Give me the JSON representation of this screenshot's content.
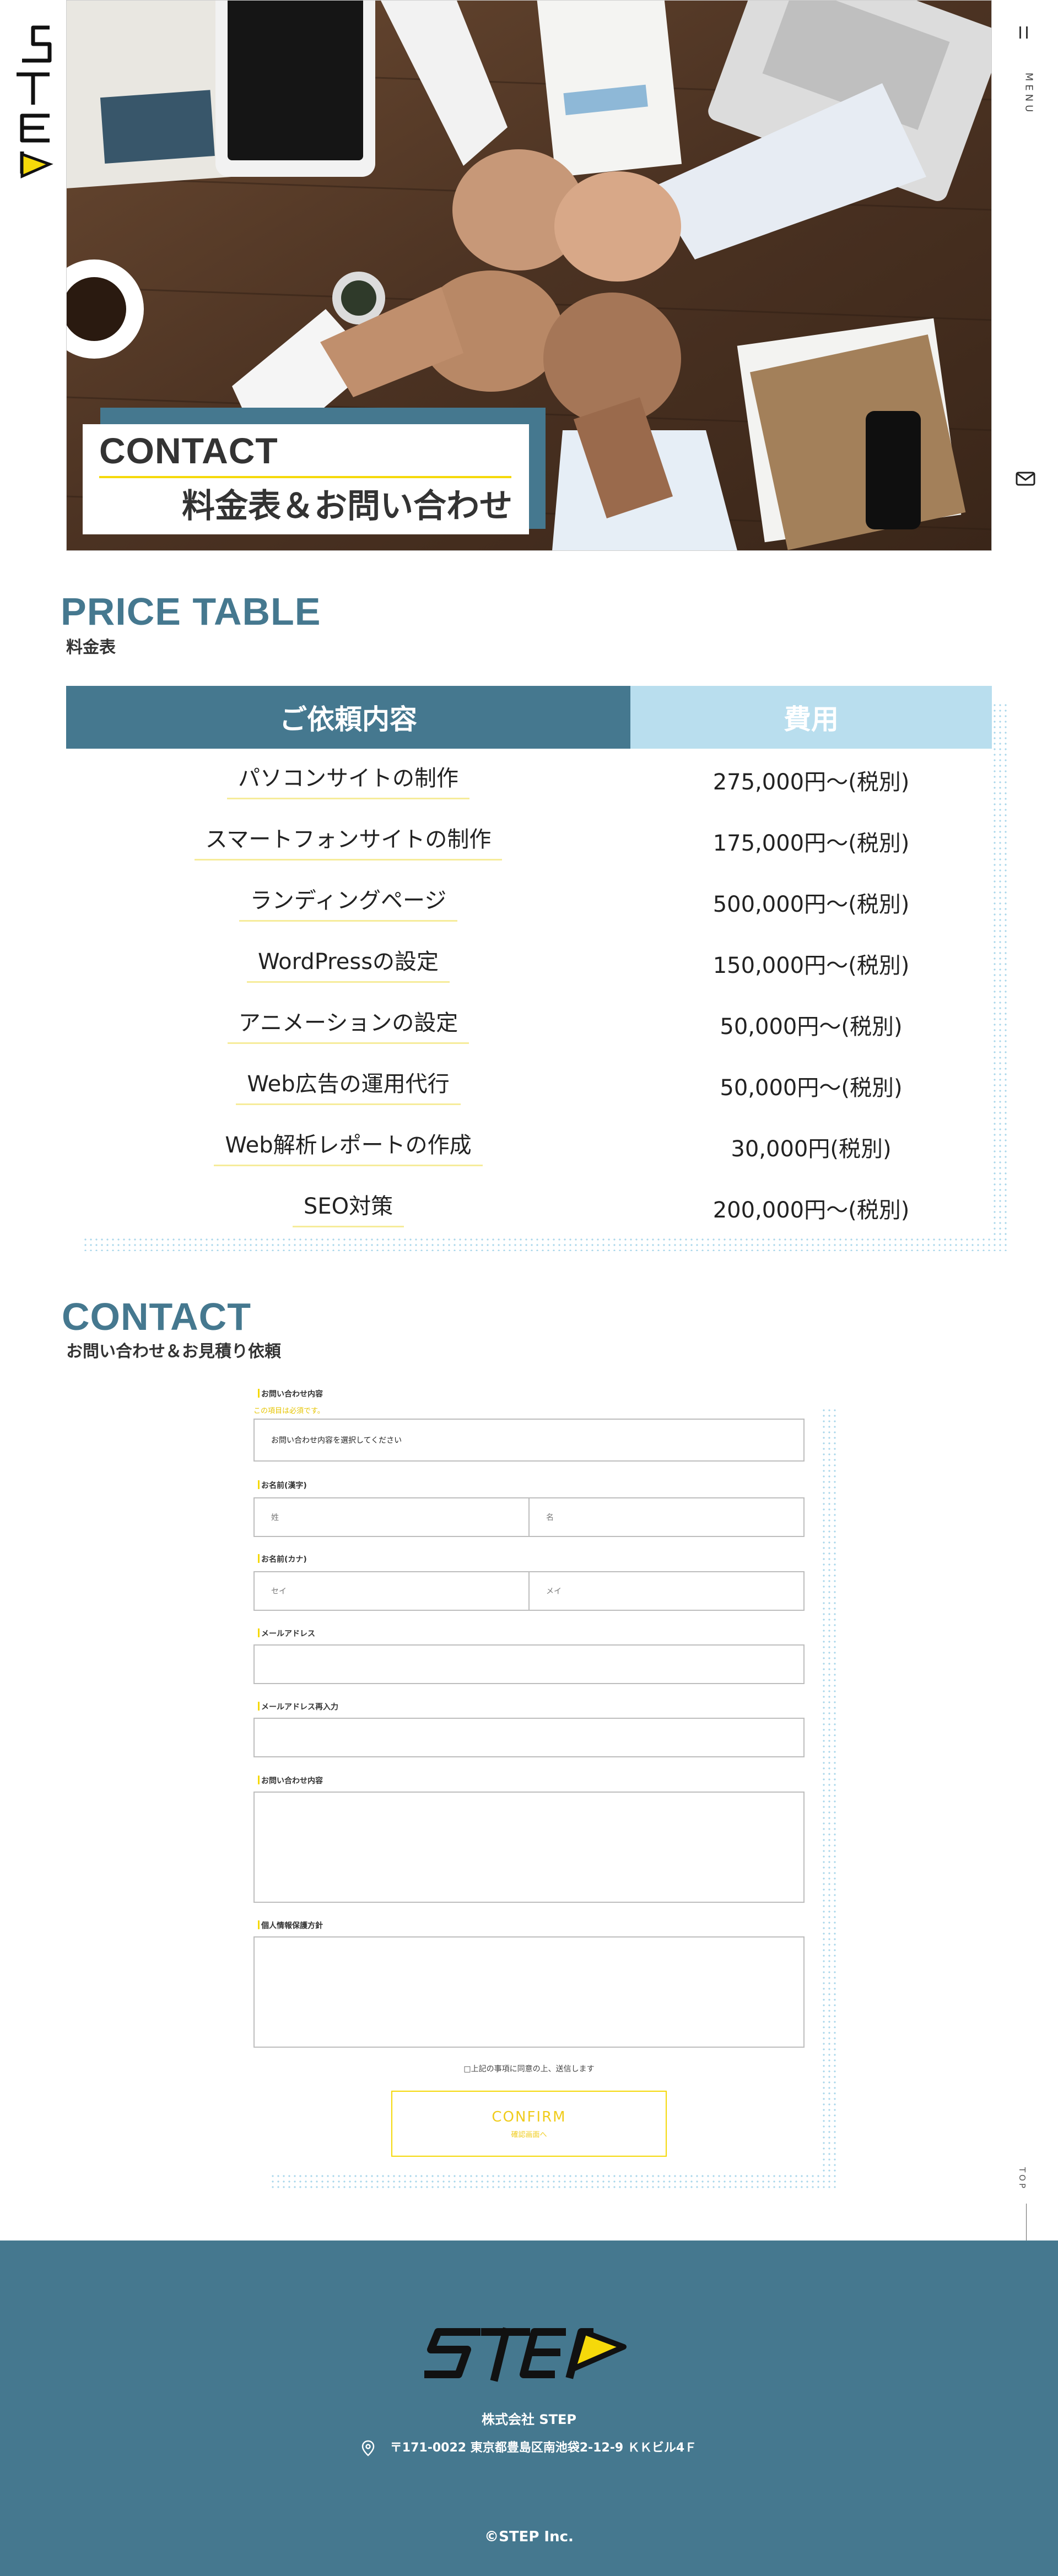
{
  "brand": {
    "logo_text": "STEP",
    "accent": "#f5d90a",
    "primary": "#45788f",
    "light": "#b9deee"
  },
  "nav": {
    "menu_label": "MENU",
    "top_label": "TOP"
  },
  "hero": {
    "title": "CONTACT",
    "subtitle": "料金表＆お問い合わせ"
  },
  "price_section": {
    "title": "PRICE TABLE",
    "subtitle": "料金表",
    "headers": {
      "item": "ご依頼内容",
      "price": "費用"
    },
    "rows": [
      {
        "item": "パソコンサイトの制作",
        "price": "275,000円〜(税別)"
      },
      {
        "item": "スマートフォンサイトの制作",
        "price": "175,000円〜(税別)"
      },
      {
        "item": "ランディングページ",
        "price": "500,000円〜(税別)"
      },
      {
        "item": "WordPressの設定",
        "price": "150,000円〜(税別)"
      },
      {
        "item": "アニメーションの設定",
        "price": "50,000円〜(税別)"
      },
      {
        "item": "Web広告の運用代行",
        "price": "50,000円〜(税別)"
      },
      {
        "item": "Web解析レポートの作成",
        "price": "30,000円(税別)"
      },
      {
        "item": "SEO対策",
        "price": "200,000円〜(税別)"
      }
    ]
  },
  "contact_section": {
    "title": "CONTACT",
    "subtitle": "お問い合わせ＆お見積り依頼",
    "form": {
      "inquiry_type_label": "お問い合わせ内容",
      "inquiry_type_note": "この項目は必須です。",
      "inquiry_type_value": "お問い合わせ内容を選択してください",
      "name_label": "お名前(漢字)",
      "last_name_placeholder": "姓",
      "first_name_placeholder": "名",
      "kana_label": "お名前(カナ)",
      "last_kana_placeholder": "セイ",
      "first_kana_placeholder": "メイ",
      "email_label": "メールアドレス",
      "email_confirm_label": "メールアドレス再入力",
      "message_label": "お問い合わせ内容",
      "privacy_label": "個人情報保護方針",
      "agree_text": "□上記の事項に同意の上、送信します",
      "confirm_label": "CONFIRM",
      "confirm_sub": "確認画面へ"
    }
  },
  "footer": {
    "logo_text": "STEP",
    "company": "株式会社 STEP",
    "address": "〒171-0022 東京都豊島区南池袋2-12-9 ＫＫビル4Ｆ",
    "copyright": "©STEP Inc."
  }
}
